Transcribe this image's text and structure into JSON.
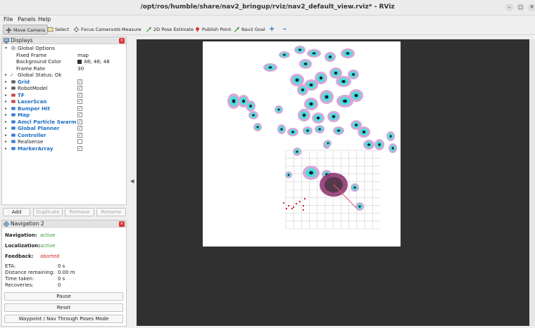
{
  "window": {
    "title": "/opt/ros/humble/share/nav2_bringup/rviz/nav2_default_view.rviz* - RViz",
    "minimize": "–",
    "maximize": "□",
    "close": "✕"
  },
  "menu": {
    "file": "File",
    "panels": "Panels",
    "help": "Help"
  },
  "toolbar": {
    "move_camera": "Move Camera",
    "select": "Select",
    "focus_camera": "Focus Camera",
    "measure": "Measure",
    "pose_estimate": "2D Pose Estimate",
    "publish_point": "Publish Point",
    "nav2_goal": "Nav2 Goal",
    "add": "+",
    "remove": "–"
  },
  "displays": {
    "title": "Displays",
    "close": "×",
    "global_options": "Global Options",
    "fixed_frame_label": "Fixed Frame",
    "fixed_frame_value": "map",
    "background_label": "Background Color",
    "background_value": "48; 48; 48",
    "background_color": "#303030",
    "frame_rate_label": "Frame Rate",
    "frame_rate_value": "30",
    "global_status": "Global Status: Ok",
    "items": [
      {
        "label": "Grid",
        "checked": true
      },
      {
        "label": "RobotModel",
        "checked": true
      },
      {
        "label": "TF",
        "checked": true
      },
      {
        "label": "LaserScan",
        "checked": true
      },
      {
        "label": "Bumper Hit",
        "checked": true
      },
      {
        "label": "Map",
        "checked": true
      },
      {
        "label": "Amcl Particle Swarm",
        "checked": true
      },
      {
        "label": "Global Planner",
        "checked": true
      },
      {
        "label": "Controller",
        "checked": true
      },
      {
        "label": "Realsense",
        "checked": false
      },
      {
        "label": "MarkerArray",
        "checked": true
      }
    ],
    "buttons": {
      "add": "Add",
      "duplicate": "Duplicate",
      "remove": "Remove",
      "rename": "Rename"
    }
  },
  "navigation": {
    "title": "Navigation 2",
    "close": "×",
    "navigation_label": "Navigation:",
    "navigation_value": "active",
    "localization_label": "Localization:",
    "localization_value": "active",
    "feedback_label": "Feedback:",
    "feedback_value": "aborted",
    "eta_label": "ETA:",
    "eta_value": "0 s",
    "distance_label": "Distance remaining:",
    "distance_value": "0.00 m",
    "time_label": "Time taken:",
    "time_value": "0 s",
    "recoveries_label": "Recoveries:",
    "recoveries_value": "0",
    "pause_button": "Pause",
    "reset_button": "Reset",
    "waypoint_button": "Waypoint / Nav Through Poses Mode"
  },
  "colors": {
    "active": "#2e9d2e",
    "aborted": "#d62020",
    "link_blue": "#1d6fc4",
    "costmap": "#d4a9d6",
    "inflation": "#46e0e0",
    "laser": "#cc2020"
  }
}
